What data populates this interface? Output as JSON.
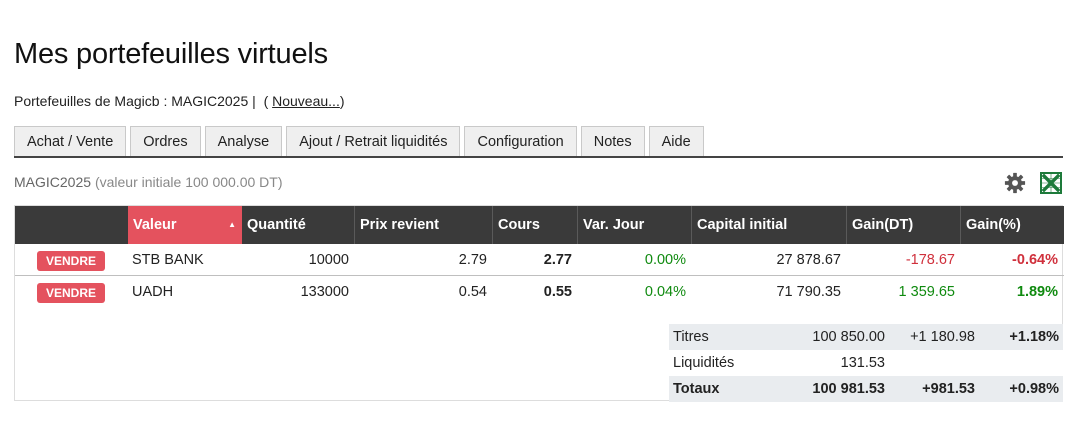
{
  "page": {
    "title": "Mes portefeuilles virtuels"
  },
  "portfolio_line": {
    "prefix": "Portefeuilles de",
    "owner": "Magicb",
    "separator": ":",
    "portfolio": "MAGIC2025 |",
    "open_paren": "(",
    "new_link": "Nouveau...",
    "close_paren": ")"
  },
  "tabs": [
    "Achat / Vente",
    "Ordres",
    "Analyse",
    "Ajout / Retrait liquidités",
    "Configuration",
    "Notes",
    "Aide"
  ],
  "subtitle": {
    "name": "MAGIC2025",
    "initial": "(valeur initiale 100 000.00 DT)"
  },
  "icons": {
    "settings": "gear-icon",
    "export": "excel-icon"
  },
  "colors": {
    "accent": "#e4525e",
    "header": "#3a3a3a",
    "positive": "#0f8a0f",
    "negative": "#d0303c"
  },
  "table": {
    "headers": [
      "Valeur",
      "Quantité",
      "Prix revient",
      "Cours",
      "Var. Jour",
      "Capital initial",
      "Gain(DT)",
      "Gain(%)"
    ],
    "sell_label": "VENDRE",
    "rows": [
      {
        "valeur": "STB BANK",
        "quantite": "10000",
        "prix_revient": "2.79",
        "cours": "2.77",
        "var_jour": "0.00%",
        "capital_initial": "27 878.67",
        "gain_dt": "-178.67",
        "gain_pct": "-0.64%"
      },
      {
        "valeur": "UADH",
        "quantite": "133000",
        "prix_revient": "0.54",
        "cours": "0.55",
        "var_jour": "0.04%",
        "capital_initial": "71 790.35",
        "gain_dt": "1 359.65",
        "gain_pct": "1.89%"
      }
    ]
  },
  "summary": [
    {
      "label": "Titres",
      "value": "100 850.00",
      "gain": "+1 180.98",
      "pct": "+1.18%"
    },
    {
      "label": "Liquidités",
      "value": "131.53",
      "gain": "",
      "pct": ""
    },
    {
      "label": "Totaux",
      "value": "100 981.53",
      "gain": "+981.53",
      "pct": "+0.98%"
    }
  ]
}
